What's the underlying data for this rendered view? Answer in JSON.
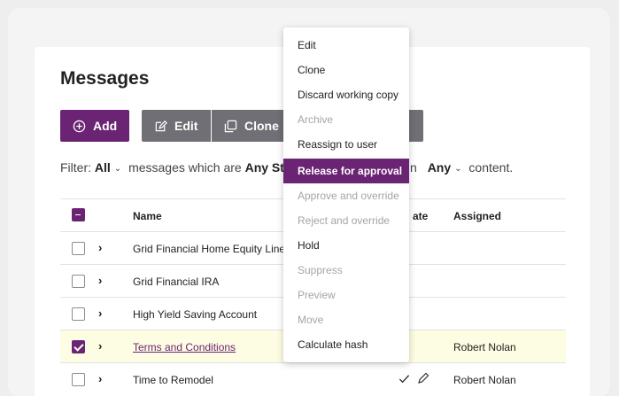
{
  "page": {
    "title": "Messages"
  },
  "toolbar": {
    "add_label": "Add",
    "edit_label": "Edit",
    "clone_label": "Clone"
  },
  "filter": {
    "prefix": "Filter:",
    "all": "All",
    "middle": "messages which are",
    "state_partial": "Any St",
    "suffix_pre": "n",
    "any": "Any",
    "suffix": "content."
  },
  "table": {
    "headers": {
      "name": "Name",
      "state_partial": "ate",
      "assigned": "Assigned"
    },
    "rows": [
      {
        "name": "Grid Financial Home Equity Line o",
        "assigned": "",
        "checked": false,
        "highlight": false
      },
      {
        "name": "Grid Financial IRA",
        "assigned": "",
        "checked": false,
        "highlight": false
      },
      {
        "name": "High Yield Saving Account",
        "assigned": "",
        "checked": false,
        "highlight": false
      },
      {
        "name": "Terms and Conditions",
        "assigned": "Robert Nolan",
        "checked": true,
        "highlight": true
      },
      {
        "name": "Time to Remodel",
        "assigned": "Robert Nolan",
        "checked": false,
        "highlight": false
      }
    ]
  },
  "menu": {
    "items": [
      {
        "label": "Edit",
        "state": "enabled"
      },
      {
        "label": "Clone",
        "state": "enabled"
      },
      {
        "label": "Discard working copy",
        "state": "enabled"
      },
      {
        "label": "Archive",
        "state": "disabled"
      },
      {
        "label": "Reassign to user",
        "state": "enabled"
      },
      {
        "label": "Release for approval",
        "state": "active"
      },
      {
        "label": "Approve and override",
        "state": "disabled"
      },
      {
        "label": "Reject and override",
        "state": "disabled"
      },
      {
        "label": "Hold",
        "state": "enabled"
      },
      {
        "label": "Suppress",
        "state": "disabled"
      },
      {
        "label": "Preview",
        "state": "disabled"
      },
      {
        "label": "Move",
        "state": "disabled"
      },
      {
        "label": "Calculate hash",
        "state": "enabled"
      }
    ]
  },
  "colors": {
    "accent": "#6b2473",
    "button_gray": "#6f6f75",
    "highlight_row": "#fdfde3"
  },
  "icons": [
    "plus-circle-icon",
    "edit-icon",
    "clone-icon",
    "chevron-down-icon",
    "chevron-right-icon",
    "checkmark-icon",
    "pencil-icon"
  ]
}
